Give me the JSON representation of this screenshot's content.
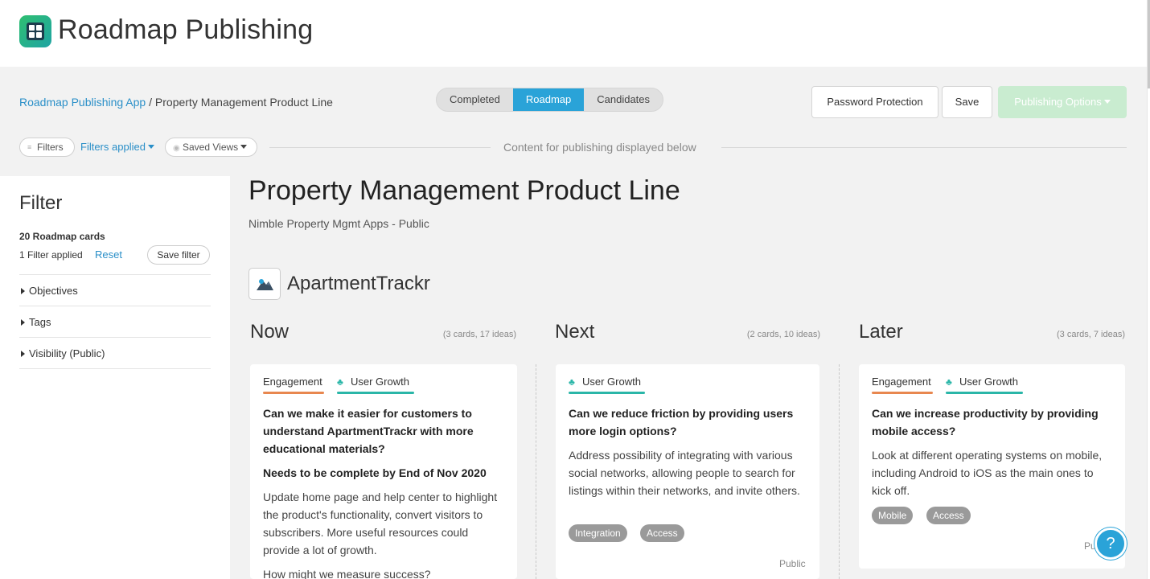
{
  "app": {
    "title": "Roadmap Publishing"
  },
  "breadcrumb": {
    "parent": "Roadmap Publishing App",
    "separator": " / ",
    "current": "Property Management Product Line"
  },
  "view_tabs": [
    {
      "label": "Completed",
      "active": false
    },
    {
      "label": "Roadmap",
      "active": true
    },
    {
      "label": "Candidates",
      "active": false
    }
  ],
  "actions": {
    "password": "Password Protection",
    "save": "Save",
    "publishing": "Publishing Options"
  },
  "filter_bar": {
    "filters": "Filters",
    "applied": "Filters applied",
    "saved_views": "Saved Views",
    "caption": "Content for publishing displayed below"
  },
  "filter_panel": {
    "title": "Filter",
    "count": "20 Roadmap cards",
    "applied": "1 Filter applied",
    "reset": "Reset",
    "save_filter": "Save filter",
    "sections": [
      "Objectives",
      "Tags",
      "Visibility (Public)"
    ]
  },
  "page": {
    "title": "Property Management Product Line",
    "subtitle": "Nimble Property Mgmt Apps - Public"
  },
  "product": {
    "name": "ApartmentTrackr"
  },
  "columns": [
    {
      "title": "Now",
      "meta": "(3 cards, 17 ideas)"
    },
    {
      "title": "Next",
      "meta": "(2 cards, 10 ideas)"
    },
    {
      "title": "Later",
      "meta": "(3 cards, 7 ideas)"
    }
  ],
  "cards": [
    {
      "tags": [
        "Engagement",
        "User Growth"
      ],
      "title": "Can we make it easier for customers to understand ApartmentTrackr with more educational materials?",
      "subtitle": "Needs to be complete by End of Nov 2020",
      "body": "Update home page and help center to highlight the product's functionality, convert visitors to subscribers. More useful resources could provide a lot of growth.",
      "extra": "How might we measure success?"
    },
    {
      "tags": [
        "User Growth"
      ],
      "title": "Can we reduce friction by providing users more login options?",
      "body": "Address possibility of integrating with various social networks, allowing people to search for listings within their networks, and invite others.",
      "pills": [
        "Integration",
        "Access"
      ],
      "visibility": "Public"
    },
    {
      "tags": [
        "Engagement",
        "User Growth"
      ],
      "title": "Can we increase productivity by providing mobile access?",
      "body": "Look at different operating systems on mobile, including Android to iOS as the main ones to kick off.",
      "pills": [
        "Mobile",
        "Access"
      ],
      "visibility": "Pu"
    }
  ],
  "colors": {
    "accent": "#2aa3d8",
    "engagement": "#e8874f",
    "user_growth": "#2ab6a8",
    "link": "#2a8fc8"
  },
  "help": {
    "icon": "question-icon"
  }
}
